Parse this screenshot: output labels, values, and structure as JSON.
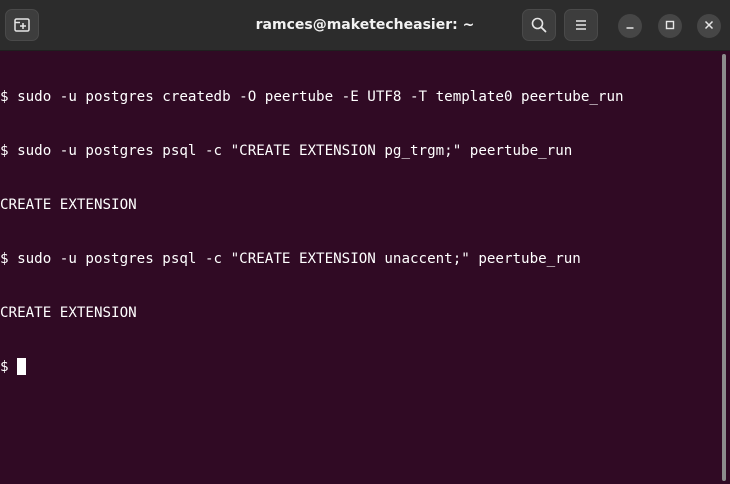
{
  "window": {
    "title": "ramces@maketecheasier: ~"
  },
  "titlebar": {
    "icons": {
      "new_tab": "new-tab-icon",
      "search": "search-icon",
      "menu": "hamburger-menu-icon",
      "minimize": "minimize-icon",
      "maximize": "maximize-icon",
      "close": "close-icon"
    }
  },
  "terminal": {
    "lines": [
      "$ sudo -u postgres createdb -O peertube -E UTF8 -T template0 peertube_run",
      "$ sudo -u postgres psql -c \"CREATE EXTENSION pg_trgm;\" peertube_run",
      "CREATE EXTENSION",
      "$ sudo -u postgres psql -c \"CREATE EXTENSION unaccent;\" peertube_run",
      "CREATE EXTENSION"
    ],
    "prompt": "$"
  },
  "colors": {
    "terminal_background": "#300a24",
    "titlebar_background": "#2c2c2c",
    "text": "#ffffff"
  }
}
